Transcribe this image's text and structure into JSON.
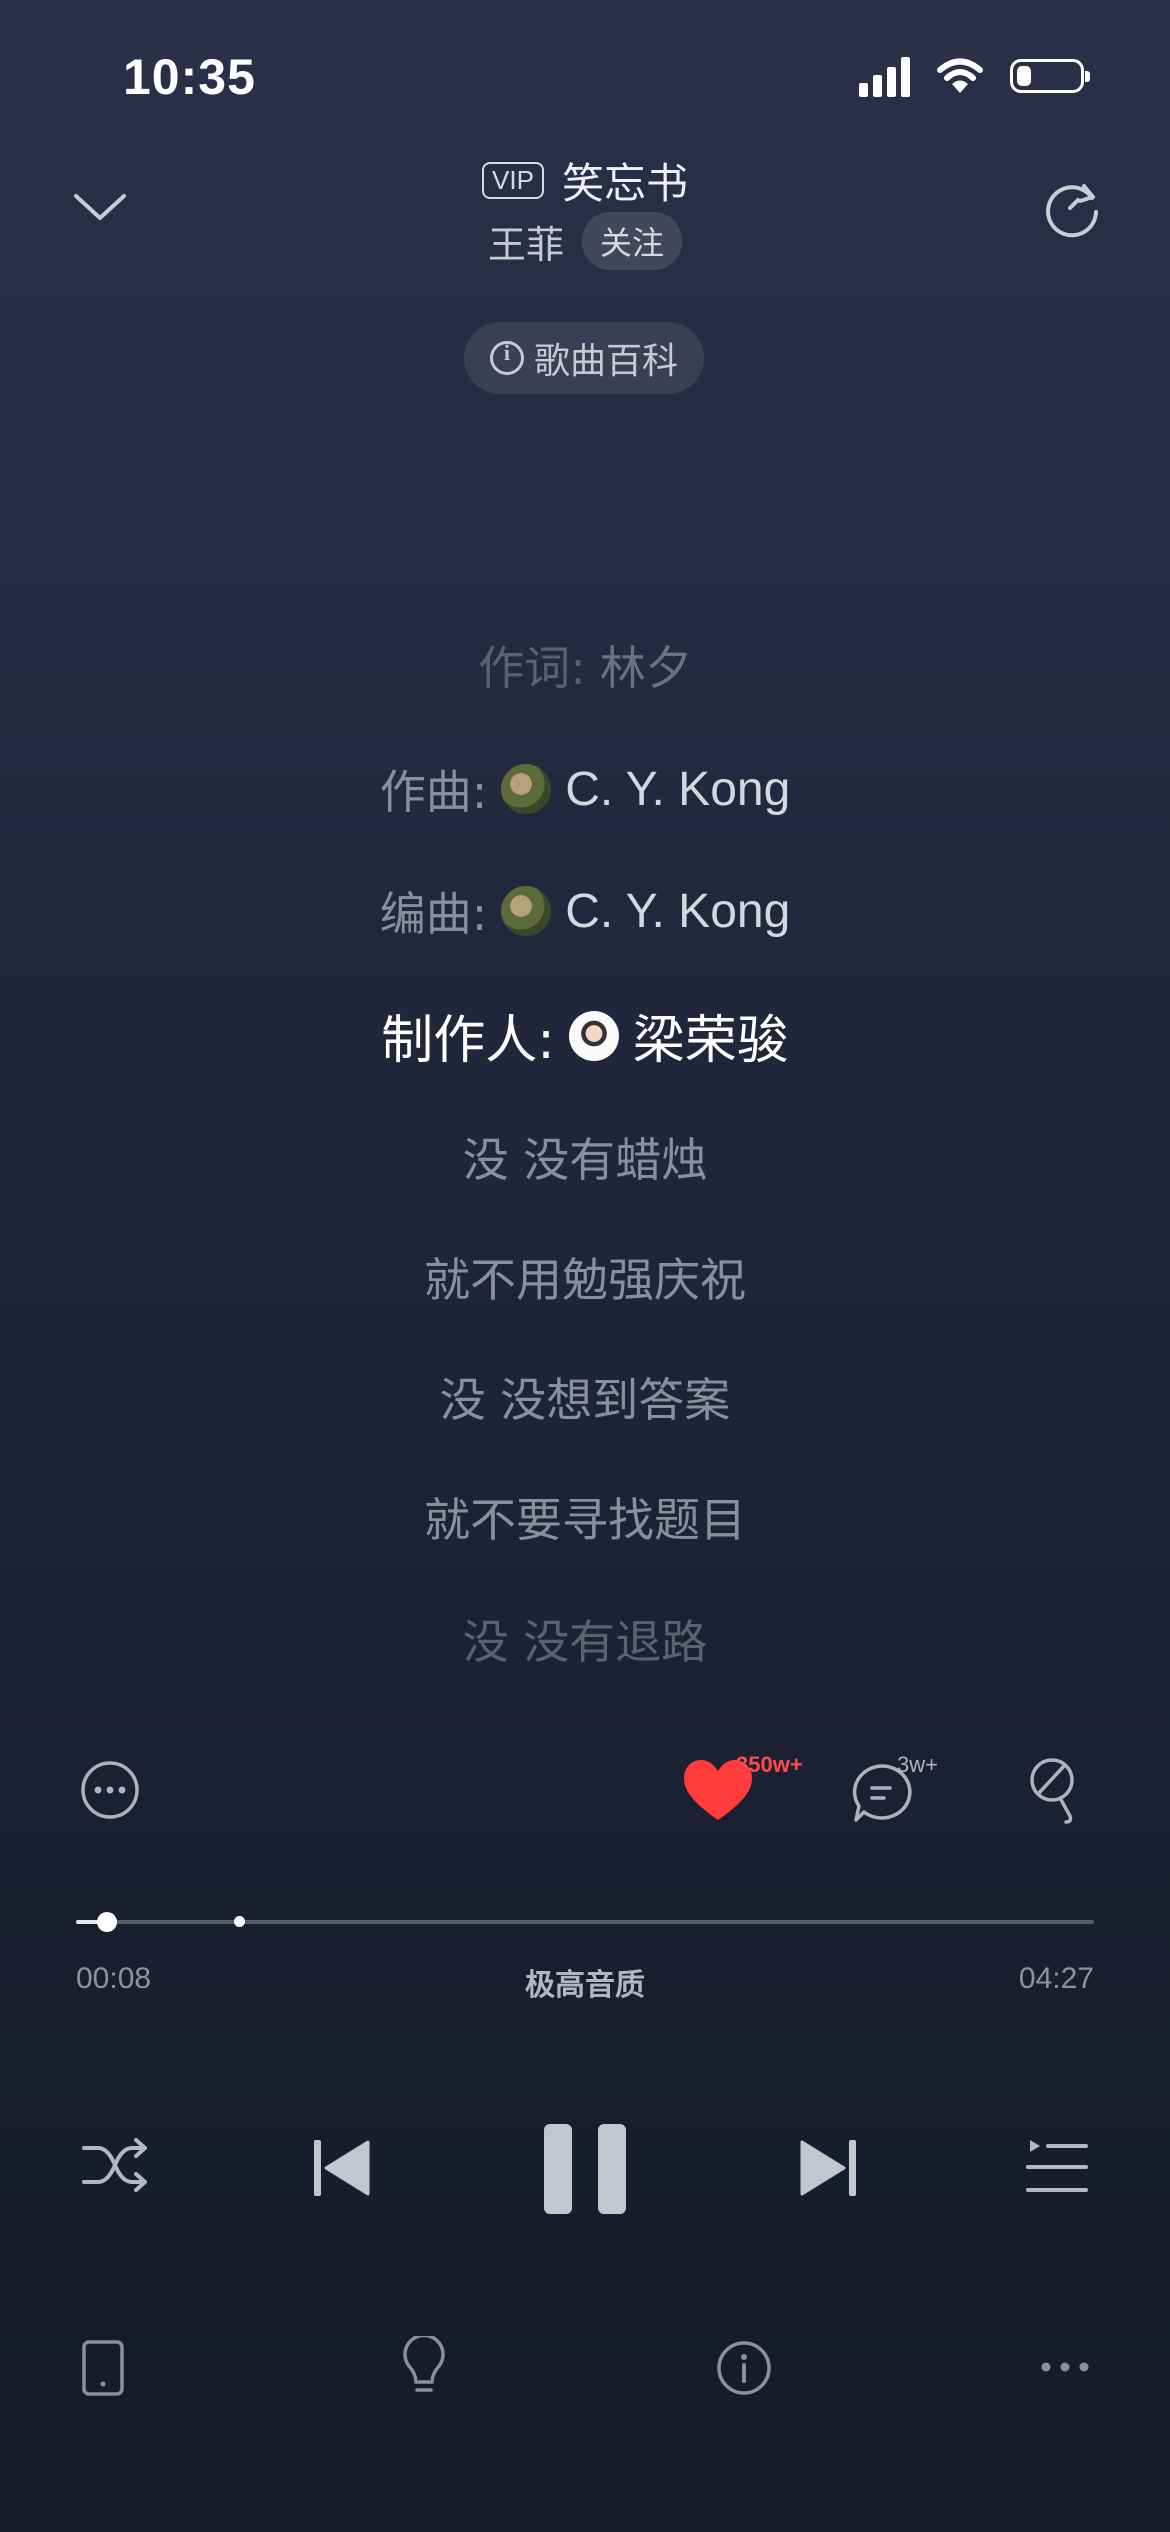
{
  "status": {
    "time": "10:35",
    "battery_level": 0.22
  },
  "header": {
    "vip_badge": "VIP",
    "song_title": "笑忘书",
    "artist": "王菲",
    "follow_label": "关注",
    "wiki_label": "歌曲百科"
  },
  "lyrics": [
    {
      "label": "作词:",
      "value": "林夕"
    },
    {
      "label": "作曲:",
      "value": "C. Y. Kong"
    },
    {
      "label": "编曲:",
      "value": "C. Y. Kong"
    },
    {
      "label": "制作人:",
      "value": "梁荣骏"
    },
    {
      "text": "没 没有蜡烛"
    },
    {
      "text": "就不用勉强庆祝"
    },
    {
      "text": "没 没想到答案"
    },
    {
      "text": "就不要寻找题目"
    },
    {
      "text": "没 没有退路"
    }
  ],
  "actions": {
    "like_count": "350w+",
    "comment_count": "3w+",
    "accent_color": "#ff4a4a"
  },
  "progress": {
    "current_time": "00:08",
    "total_time": "04:27",
    "quality": "极高音质",
    "played_fraction": 0.03,
    "buffered_fraction": 0.16
  },
  "icons": {
    "back": "chevron-down-icon",
    "refresh": "refresh-icon",
    "more": "more-circle-icon",
    "like": "heart-icon",
    "comment": "comment-icon",
    "sing": "microphone-icon",
    "shuffle": "shuffle-icon",
    "previous": "previous-icon",
    "pause": "pause-icon",
    "next": "next-icon",
    "playlist": "playlist-icon",
    "device": "phone-device-icon",
    "tip": "lightbulb-icon",
    "info": "info-icon",
    "overflow": "more-horizontal-icon"
  }
}
